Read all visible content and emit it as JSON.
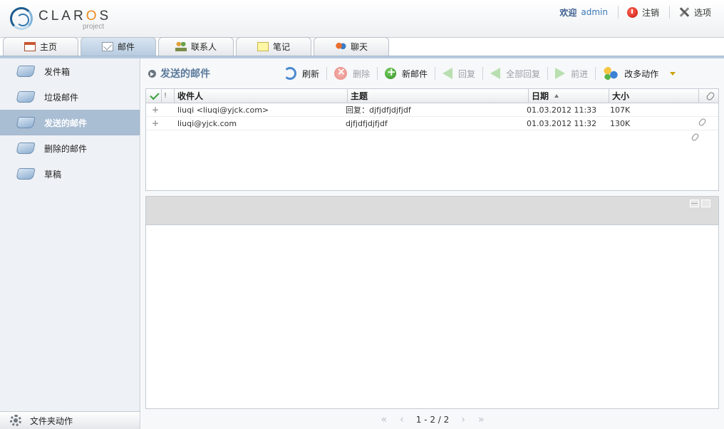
{
  "app": {
    "logo_text_main": "CLAR",
    "logo_text_o": "O",
    "logo_text_end": "S",
    "logo_sub": "project"
  },
  "header": {
    "welcome": "欢迎",
    "username": "admin",
    "logout_label": "注销",
    "options_label": "选项"
  },
  "tabs": [
    {
      "label": "主页",
      "icon": "home-icon"
    },
    {
      "label": "邮件",
      "icon": "mail-icon",
      "active": true
    },
    {
      "label": "联系人",
      "icon": "contacts-icon"
    },
    {
      "label": "笔记",
      "icon": "note-icon"
    },
    {
      "label": "聊天",
      "icon": "chat-icon"
    }
  ],
  "sidebar": {
    "folders": [
      {
        "label": "发件箱"
      },
      {
        "label": "垃圾邮件"
      },
      {
        "label": "发送的邮件",
        "active": true
      },
      {
        "label": "删除的邮件"
      },
      {
        "label": "草稿"
      }
    ],
    "footer_label": "文件夹动作"
  },
  "toolbar": {
    "folder_title": "发送的邮件",
    "refresh": "刷新",
    "delete": "删除",
    "new_mail": "新邮件",
    "reply": "回复",
    "reply_all": "全部回复",
    "forward": "前进",
    "more_actions": "改多动作"
  },
  "mail_list": {
    "columns": {
      "flags": "!",
      "recipient": "收件人",
      "subject": "主题",
      "date": "日期",
      "size": "大小"
    },
    "rows": [
      {
        "recipient": "liuqi <liuqi@yjck.com>",
        "subject": "回复：djfjdfjdjfjdf",
        "date": "01.03.2012 11:33",
        "size": "107K",
        "attachment": false
      },
      {
        "recipient": "liuqi@yjck.com",
        "subject": "djfjdfjdjfjdf",
        "date": "01.03.2012 11:32",
        "size": "130K",
        "attachment": true
      }
    ]
  },
  "pager": {
    "first": "«",
    "prev": "‹",
    "text": "1 - 2 / 2",
    "next": "›",
    "last": "»"
  }
}
